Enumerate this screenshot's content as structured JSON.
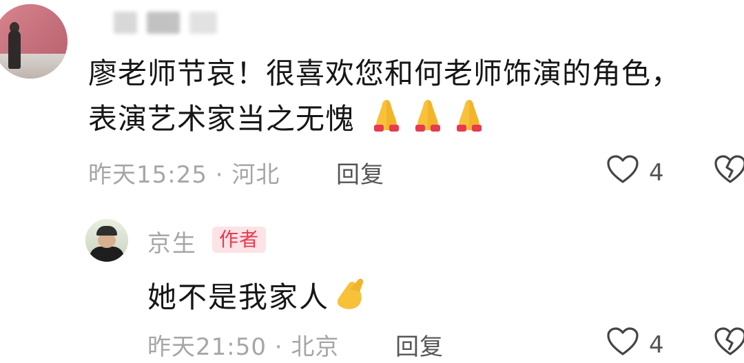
{
  "comment": {
    "text_line1": "廖老师节哀！很喜欢您和何老师饰演的角色，",
    "text_line2": "表演艺术家当之无愧",
    "emoji_icons": [
      "pray-icon",
      "pray-icon",
      "pray-icon"
    ],
    "time_location": "昨天15:25 · 河北",
    "reply_label": "回复",
    "like_count": "4"
  },
  "reply": {
    "author": "京生",
    "author_badge": "作者",
    "text": "她不是我家人",
    "emoji_icon": "pray-icon",
    "time_location": "昨天21:50 · 北京",
    "reply_label": "回复",
    "like_count": "4"
  },
  "colors": {
    "badge_text": "#e8394f",
    "badge_bg": "#fde3e6",
    "meta_text": "#a6a6a6"
  }
}
